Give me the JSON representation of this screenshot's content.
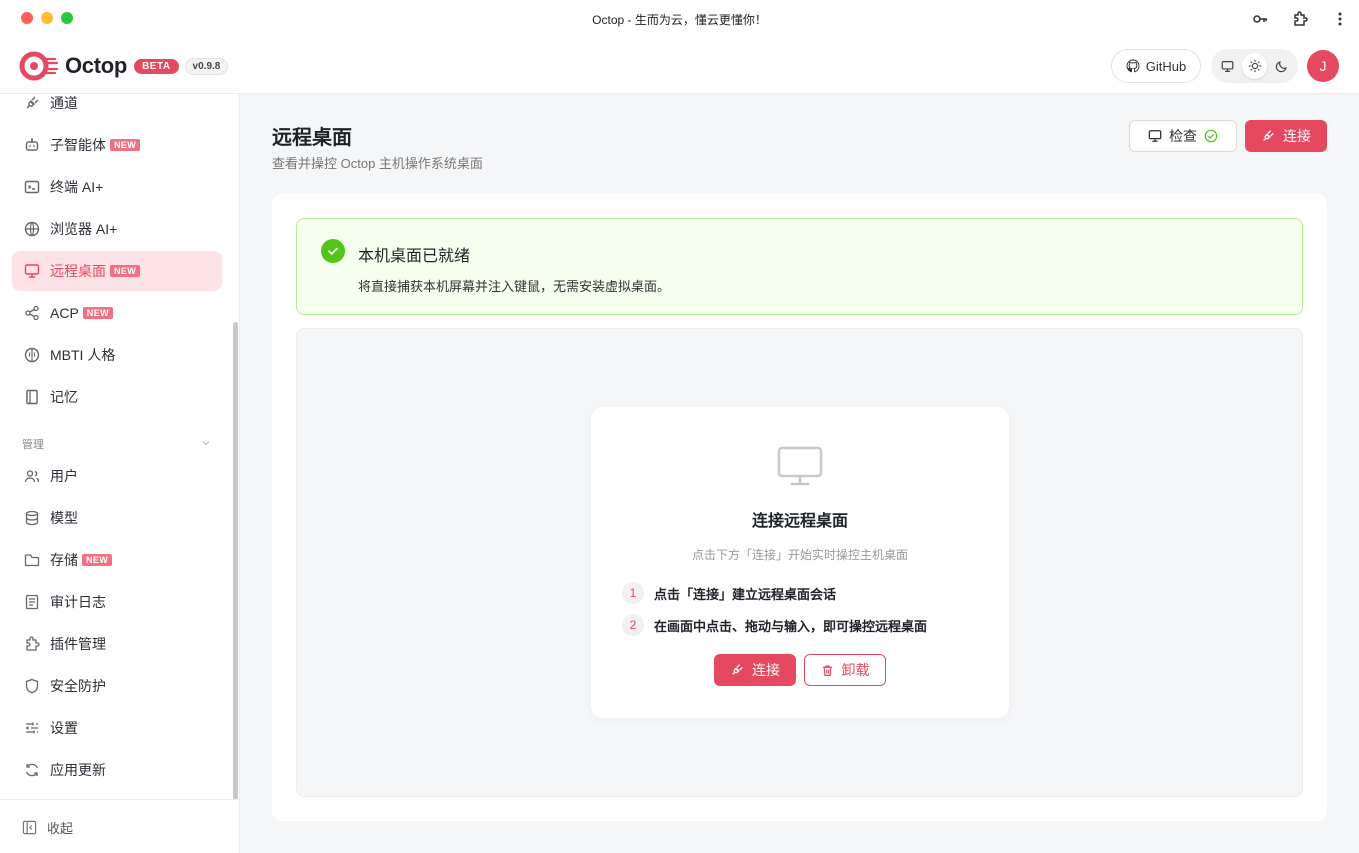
{
  "window": {
    "title": "Octop - 生而为云，懂云更懂你！"
  },
  "header": {
    "logo_text": "Octop",
    "beta": "BETA",
    "version": "v0.9.8",
    "github_label": "GitHub",
    "avatar_initial": "J",
    "theme_selected": "light"
  },
  "sidebar": {
    "items": [
      {
        "label": "通道",
        "icon": "plug-icon",
        "badge": ""
      },
      {
        "label": "子智能体",
        "icon": "bot-icon",
        "badge": "NEW"
      },
      {
        "label": "终端 AI+",
        "icon": "terminal-icon",
        "badge": ""
      },
      {
        "label": "浏览器 AI+",
        "icon": "globe-icon",
        "badge": ""
      },
      {
        "label": "远程桌面",
        "icon": "monitor-icon",
        "badge": "NEW",
        "active": true
      },
      {
        "label": "ACP",
        "icon": "share-icon",
        "badge": "NEW"
      },
      {
        "label": "MBTI 人格",
        "icon": "brain-icon",
        "badge": ""
      },
      {
        "label": "记忆",
        "icon": "notebook-icon",
        "badge": ""
      }
    ],
    "section_label": "管理",
    "manage_items": [
      {
        "label": "用户",
        "icon": "users-icon",
        "badge": ""
      },
      {
        "label": "模型",
        "icon": "database-icon",
        "badge": ""
      },
      {
        "label": "存储",
        "icon": "folder-icon",
        "badge": "NEW"
      },
      {
        "label": "审计日志",
        "icon": "log-icon",
        "badge": ""
      },
      {
        "label": "插件管理",
        "icon": "puzzle-icon",
        "badge": ""
      },
      {
        "label": "安全防护",
        "icon": "shield-icon",
        "badge": ""
      },
      {
        "label": "设置",
        "icon": "sliders-icon",
        "badge": ""
      },
      {
        "label": "应用更新",
        "icon": "refresh-icon",
        "badge": ""
      }
    ],
    "collapse_label": "收起"
  },
  "main": {
    "title": "远程桌面",
    "subtitle": "查看并操控 Octop 主机操作系统桌面",
    "check_label": "检查",
    "connect_label": "连接",
    "alert": {
      "title": "本机桌面已就绪",
      "desc": "将直接捕获本机屏幕并注入键鼠，无需安装虚拟桌面。"
    },
    "panel": {
      "title": "连接远程桌面",
      "subtitle": "点击下方「连接」开始实时操控主机桌面",
      "steps": [
        {
          "num": "1",
          "text": "点击「连接」建立远程桌面会话"
        },
        {
          "num": "2",
          "text": "在画面中点击、拖动与输入，即可操控远程桌面"
        }
      ],
      "connect_label": "连接",
      "uninstall_label": "卸载"
    }
  },
  "colors": {
    "accent": "#e5485f",
    "success": "#52c41a"
  }
}
